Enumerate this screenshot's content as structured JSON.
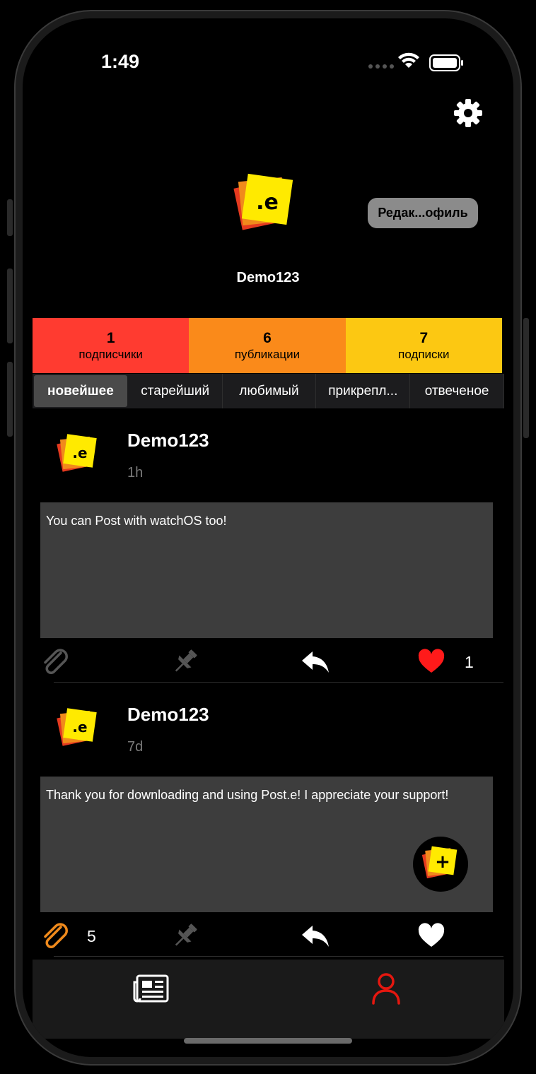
{
  "status_bar": {
    "time": "1:49"
  },
  "header": {
    "edit_profile_label": "Редак...офиль"
  },
  "profile": {
    "username": "Demo123"
  },
  "stats": [
    {
      "value": "1",
      "label": "подписчики",
      "color": "#ff3b30"
    },
    {
      "value": "6",
      "label": "публикации",
      "color": "#fa8a1a"
    },
    {
      "value": "7",
      "label": "подписки",
      "color": "#fcc812"
    }
  ],
  "sort_tabs": [
    "новейшее",
    "старейший",
    "любимый",
    "прикрепл...",
    "отвеченое"
  ],
  "posts": [
    {
      "author": "Demo123",
      "time": "1h",
      "text": "You can Post with watchOS too!",
      "like_count": "1",
      "attach_count": ""
    },
    {
      "author": "Demo123",
      "time": "7d",
      "text": "Thank you for downloading and using Post.e! I appreciate your support!",
      "like_count": "",
      "attach_count": "5"
    }
  ],
  "icons": {
    "settings": "gear-icon",
    "attach": "paperclip-icon",
    "pin": "pin-icon",
    "reply": "reply-icon",
    "like": "heart-icon",
    "compose": "compose-icon",
    "tab_feed": "newspaper-icon",
    "tab_profile": "person-icon"
  },
  "colors": {
    "accent_red": "#e5170f",
    "like_red": "#ff1a1a",
    "attach_orange": "#f08a1c",
    "logo_yellow": "#ffea00"
  }
}
